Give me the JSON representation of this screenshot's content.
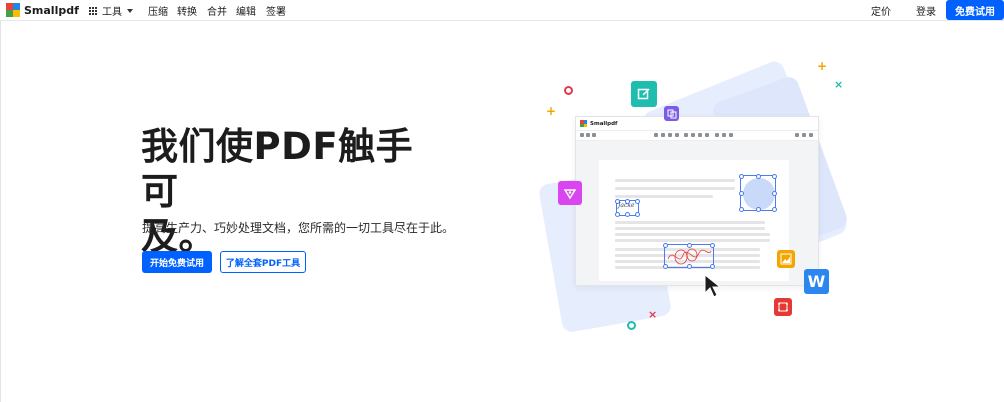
{
  "brand": {
    "name": "Smallpdf",
    "colors": [
      "#ea4335",
      "#1e88e5",
      "#43a047",
      "#fbbc05"
    ],
    "accent": "#0061fe"
  },
  "nav": {
    "tools_label": "工具",
    "links": [
      "压缩",
      "转换",
      "合并",
      "编辑",
      "签署"
    ],
    "pricing": "定价",
    "login": "登录",
    "trial": "免费试用"
  },
  "hero": {
    "title_line1": "我们使PDF触手可",
    "title_line2": "及。",
    "subtitle": "提高生产力、巧妙处理文档，您所需的一切工具尽在于此。",
    "primary_cta": "开始免费试用",
    "secondary_cta": "了解全套PDF工具"
  },
  "illustration": {
    "editor_brand": "Smallpdf",
    "signature_text": "Jacke",
    "word_icon_letter": "W"
  }
}
